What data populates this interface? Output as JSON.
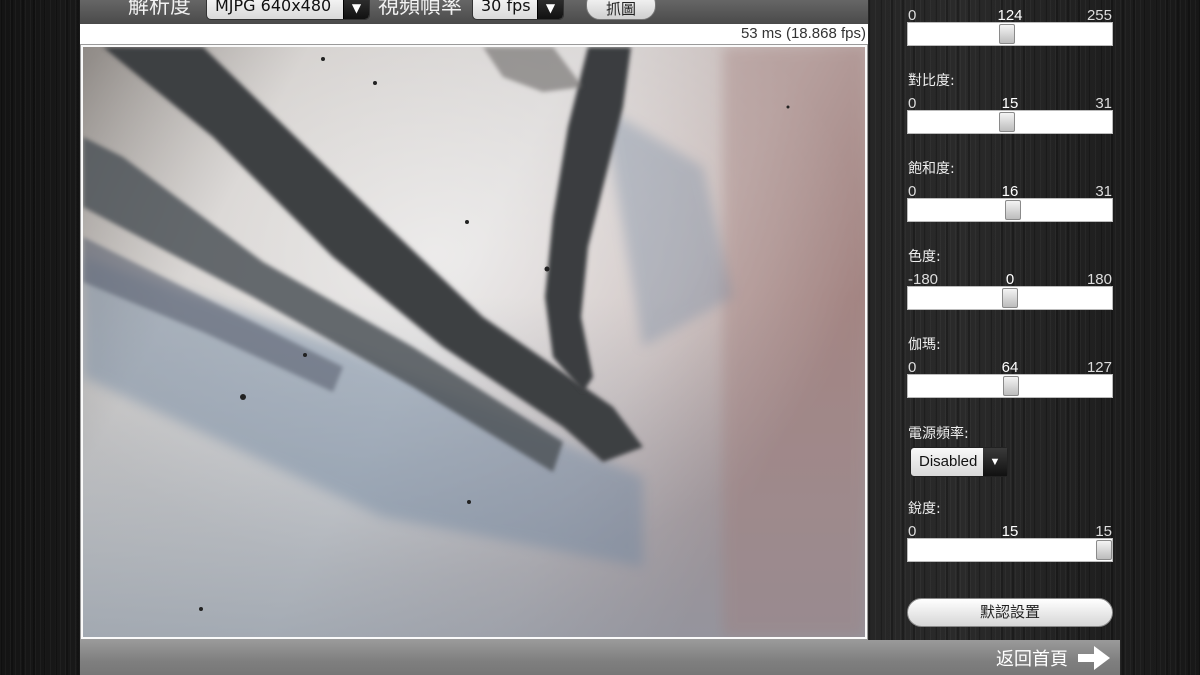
{
  "toolbar": {
    "resolution_label": "解析度",
    "resolution_value": "MJPG 640x480",
    "framerate_label": "視頻幀率",
    "framerate_value": "30 fps",
    "capture_label": "抓圖"
  },
  "status": {
    "frame_time": "53 ms (18.868 fps)"
  },
  "controls": {
    "top_slider": {
      "min": "0",
      "value": "124",
      "max": "255",
      "fraction": 0.486
    },
    "contrast": {
      "label": "對比度:",
      "min": "0",
      "value": "15",
      "max": "31",
      "fraction": 0.484
    },
    "saturation": {
      "label": "飽和度:",
      "min": "0",
      "value": "16",
      "max": "31",
      "fraction": 0.516
    },
    "hue": {
      "label": "色度:",
      "min": "-180",
      "value": "0",
      "max": "180",
      "fraction": 0.5
    },
    "gamma": {
      "label": "伽瑪:",
      "min": "0",
      "value": "64",
      "max": "127",
      "fraction": 0.504
    },
    "power_frequency": {
      "label": "電源頻率:",
      "value": "Disabled"
    },
    "sharpness": {
      "label": "銳度:",
      "min": "0",
      "value": "15",
      "max": "15",
      "fraction": 1.0
    },
    "reset_label": "默認設置"
  },
  "footer": {
    "back_home_label": "返回首頁"
  },
  "icons": {
    "select_arrow": "triangle-down-icon",
    "back_arrow": "arrow-right-icon"
  },
  "colors": {
    "panel_text": "#eeeeee",
    "toolbar_bg": "#555555",
    "bottom_bar_bg": "#8a8a8a"
  }
}
